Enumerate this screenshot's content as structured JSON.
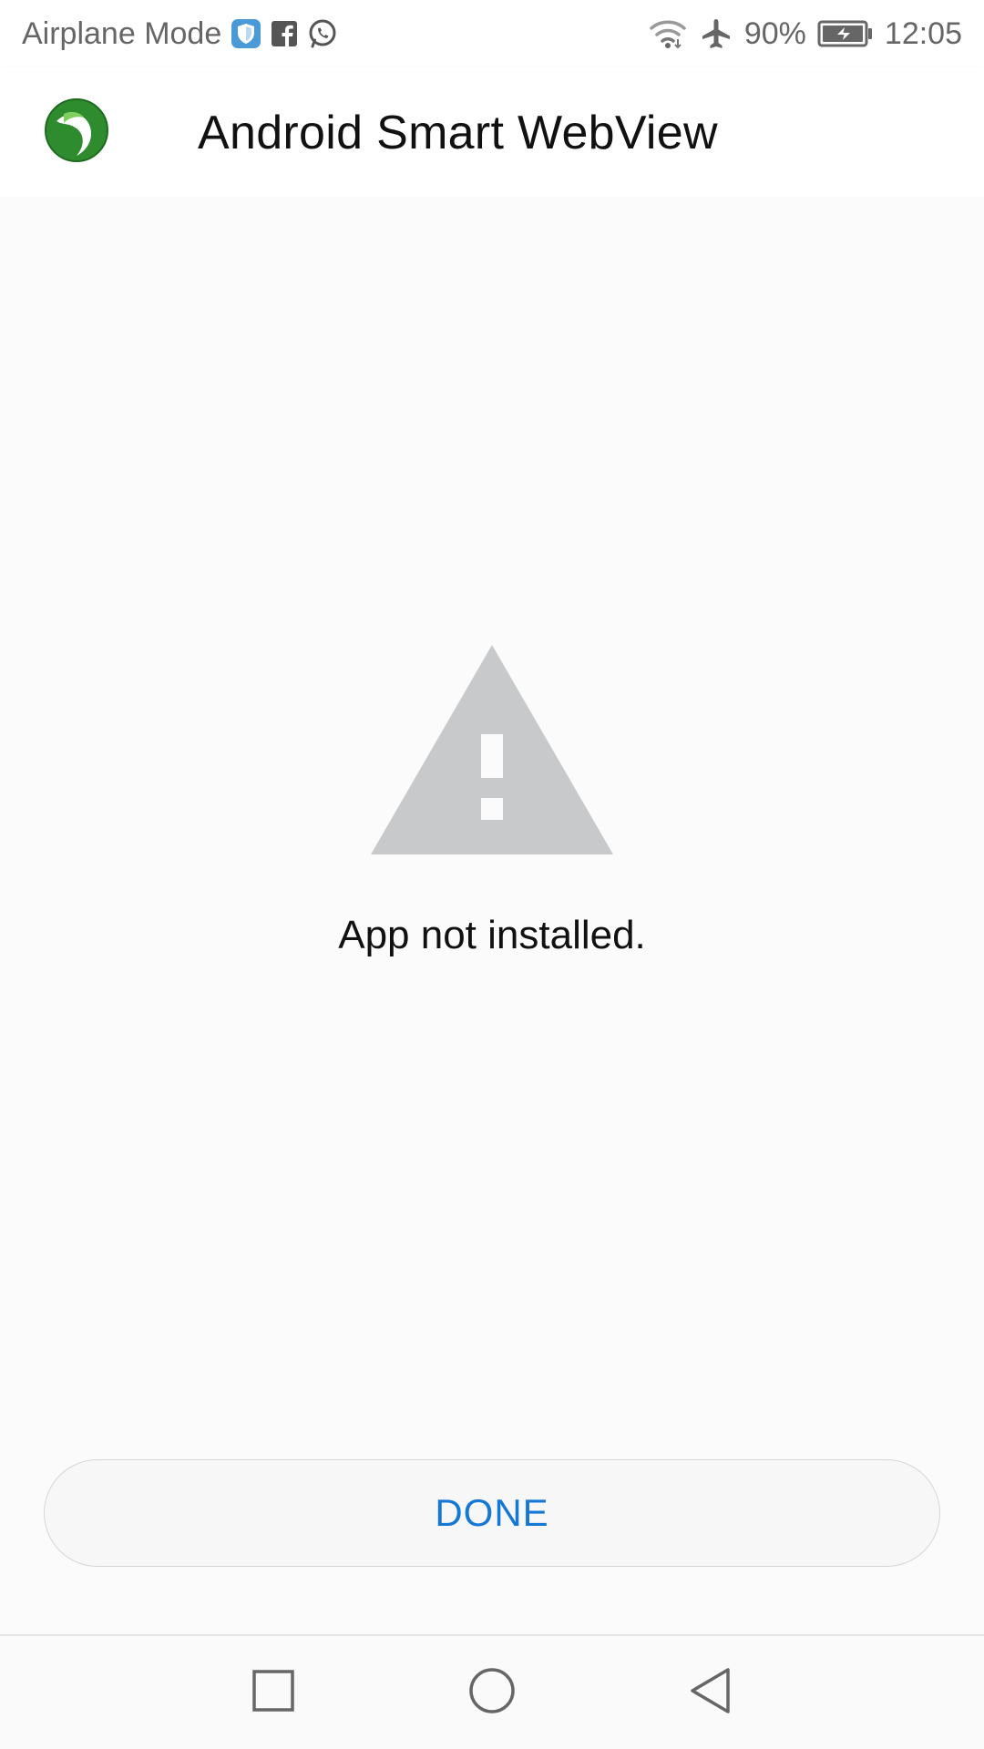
{
  "status_bar": {
    "carrier_text": "Airplane Mode",
    "battery_percent": "90%",
    "time": "12:05",
    "left_icons": [
      "shield-icon",
      "facebook-icon",
      "whatsapp-icon"
    ],
    "right_icons": [
      "wifi-icon",
      "airplane-icon",
      "battery-charging-icon"
    ]
  },
  "app_bar": {
    "title": "Android Smart WebView",
    "logo_icon": "app-logo-icon"
  },
  "dialog": {
    "icon": "warning-icon",
    "message": "App not installed.",
    "done_label": "DONE"
  },
  "nav_bar": {
    "items": [
      "recents-button",
      "home-button",
      "back-button"
    ]
  },
  "colors": {
    "accent": "#1577d6",
    "warning_icon": "#c8c9cb",
    "logo_green": "#2e8b2e",
    "status_text": "#666666"
  }
}
